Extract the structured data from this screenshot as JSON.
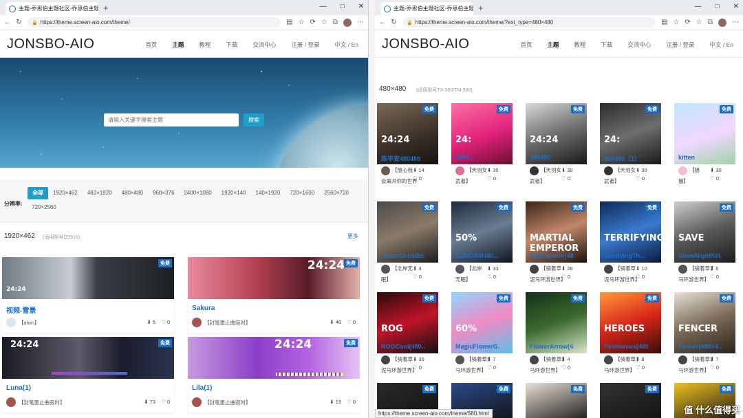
{
  "left": {
    "tab_title": "主题-乔思伯主题社区-乔思伯主题...",
    "url": "https://theme.screen-aio.com/theme/",
    "logo": "JONSBO-AIO",
    "nav": [
      "首页",
      "主题",
      "教程",
      "下载",
      "交流中心",
      "注册 / 登录",
      "中文 / En"
    ],
    "search_placeholder": "请输入关键字搜索主题",
    "search_button": "搜索",
    "filter_label": "分辨率:",
    "filters": [
      "全部",
      "1920×462",
      "462×1920",
      "480×480",
      "960×376",
      "2400×1080",
      "1920×140",
      "140×1920",
      "720×1600",
      "2560×720",
      "720×2560"
    ],
    "section_title": "1920×462",
    "section_sub": "(适用型号DS916)",
    "more": "更多",
    "cards": [
      {
        "name": "视频-雪景",
        "author": "【alvin】",
        "downloads": "5",
        "likes": "0",
        "free": "免费",
        "overlay": "24:24"
      },
      {
        "name": "Sakura",
        "author": "【封笔墨止曲寂时】",
        "downloads": "48",
        "likes": "0",
        "free": "免费",
        "overlay": "24:24"
      },
      {
        "name": "Luna(1)",
        "author": "【封笔墨止曲寂时】",
        "downloads": "73",
        "likes": "0",
        "free": "免费",
        "overlay": "24:24"
      },
      {
        "name": "Lila(1)",
        "author": "【封笔墨止曲寂时】",
        "downloads": "19",
        "likes": "0",
        "free": "免费",
        "overlay": "24:24"
      }
    ]
  },
  "right": {
    "tab_title": "主题-乔思伯主题社区-乔思伯主题...",
    "url": "https://theme.screen-aio.com/theme/?ext_type=480×480",
    "logo": "JONSBO-AIO",
    "nav": [
      "首页",
      "主题",
      "教程",
      "下载",
      "交流中心",
      "注册 / 登录",
      "中文 / En"
    ],
    "section_title": "480×480",
    "section_sub": "(适用型号TX-360/TM-360)",
    "free": "免费",
    "cards": [
      {
        "name": "陈平安480480",
        "author": "【放心我",
        "author2": "会离开你的世界",
        "downloads": "14",
        "likes": "0",
        "overlay": "24:24"
      },
      {
        "name": "4804...",
        "author": "【天羽女",
        "author2": "武者】",
        "downloads": "30",
        "likes": "0",
        "overlay": "24:"
      },
      {
        "name": "480480",
        "author": "【天羽女",
        "author2": "武者】",
        "downloads": "39",
        "likes": "0",
        "overlay": "24:24"
      },
      {
        "name": "480480（1）",
        "author": "【天羽女",
        "author2": "武者】",
        "downloads": "30",
        "likes": "0",
        "overlay": "24:"
      },
      {
        "name": "kitten",
        "author": "【猫",
        "author2": "猫】",
        "downloads": "30",
        "likes": "0",
        "overlay": ""
      },
      {
        "name": "TerrorGhostBl...",
        "author": "【北岸无",
        "author2": "眠】",
        "downloads": "4",
        "likes": "0",
        "overlay": ""
      },
      {
        "name": "GUNDAM480...",
        "author": "【北岸",
        "author2": "无眠】",
        "downloads": "33",
        "likes": "0",
        "overlay": "50%"
      },
      {
        "name": "WuEmperor(48...",
        "author": "【骑着草",
        "author2": "泥马环游世界】",
        "downloads": "28",
        "likes": "0",
        "overlay": "MARTIAL EMPEROR"
      },
      {
        "name": "TerrifyingTh...",
        "author": "【骑着草",
        "author2": "泥马环游世界】",
        "downloads": "10",
        "likes": "0",
        "overlay": "TERRIFYING"
      },
      {
        "name": "SnowNightKill...",
        "author": "【骑着草泥",
        "author2": "马环游世界】",
        "downloads": "6",
        "likes": "0",
        "overlay": "SAVE"
      },
      {
        "name": "ROGCool(480...",
        "author": "【骑着草",
        "author2": "泥马环游世界】",
        "downloads": "35",
        "likes": "0",
        "overlay": "ROG"
      },
      {
        "name": "MagicFlowerG...",
        "author": "【骑着草泥",
        "author2": "马环游世界】",
        "downloads": "7",
        "likes": "0",
        "overlay": "60%"
      },
      {
        "name": "FlowerArrow(4...",
        "author": "【骑着草泥",
        "author2": "马环游世界】",
        "downloads": "4",
        "likes": "0",
        "overlay": ""
      },
      {
        "name": "FireHeroes(480...",
        "author": "【骑着草泥",
        "author2": "马环游世界】",
        "downloads": "8",
        "likes": "0",
        "overlay": "HEROES"
      },
      {
        "name": "Fencer(480×4...",
        "author": "【骑着草泥",
        "author2": "马环游世界】",
        "downloads": "7",
        "likes": "0",
        "overlay": "FENCER"
      }
    ],
    "status_url": "https://theme.screen-aio.com/theme/580.html",
    "watermark": "值 什么值得买"
  },
  "colors": {
    "accent": "#1e9ec8",
    "link": "#1e6fc8",
    "badge": "#1b6cc4"
  }
}
